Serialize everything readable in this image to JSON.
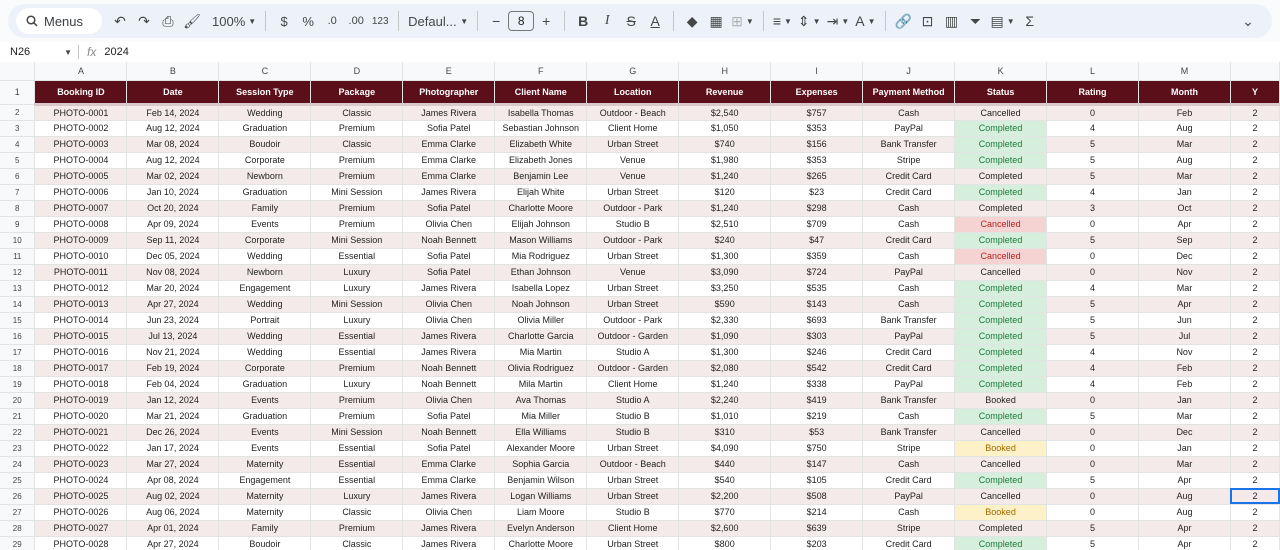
{
  "toolbar": {
    "search_label": "Menus",
    "zoom": "100%",
    "currency": "$",
    "percent": "%",
    "dec_decrease": ".0",
    "dec_increase": ".00",
    "number_format": "123",
    "font": "Defaul...",
    "font_size": "8"
  },
  "formula_bar": {
    "cell_ref": "N26",
    "fx": "fx",
    "value": "2024"
  },
  "columns": [
    "A",
    "B",
    "C",
    "D",
    "E",
    "F",
    "G",
    "H",
    "I",
    "J",
    "K",
    "L",
    "M",
    ""
  ],
  "header_row_number": "1",
  "headers": [
    "Booking ID",
    "Date",
    "Session Type",
    "Package",
    "Photographer",
    "Client Name",
    "Location",
    "Revenue",
    "Expenses",
    "Payment Method",
    "Status",
    "Rating",
    "Month",
    "Y"
  ],
  "rows": [
    {
      "n": "2",
      "cells": [
        "PHOTO-0001",
        "Feb 14, 2024",
        "Wedding",
        "Classic",
        "James Rivera",
        "Isabella Thomas",
        "Outdoor - Beach",
        "$2,540",
        "$757",
        "Cash",
        "Cancelled",
        "0",
        "Feb",
        "2"
      ]
    },
    {
      "n": "3",
      "cells": [
        "PHOTO-0002",
        "Aug 12, 2024",
        "Graduation",
        "Premium",
        "Sofia Patel",
        "Sebastian Johnson",
        "Client Home",
        "$1,050",
        "$353",
        "PayPal",
        "Completed",
        "4",
        "Aug",
        "2"
      ]
    },
    {
      "n": "4",
      "cells": [
        "PHOTO-0003",
        "Mar 08, 2024",
        "Boudoir",
        "Classic",
        "Emma Clarke",
        "Elizabeth White",
        "Urban Street",
        "$740",
        "$156",
        "Bank Transfer",
        "Completed",
        "5",
        "Mar",
        "2"
      ]
    },
    {
      "n": "5",
      "cells": [
        "PHOTO-0004",
        "Aug 12, 2024",
        "Corporate",
        "Premium",
        "Emma Clarke",
        "Elizabeth Jones",
        "Venue",
        "$1,980",
        "$353",
        "Stripe",
        "Completed",
        "5",
        "Aug",
        "2"
      ]
    },
    {
      "n": "6",
      "cells": [
        "PHOTO-0005",
        "Mar 02, 2024",
        "Newborn",
        "Premium",
        "Emma Clarke",
        "Benjamin Lee",
        "Venue",
        "$1,240",
        "$265",
        "Credit Card",
        "Completed",
        "5",
        "Mar",
        "2"
      ]
    },
    {
      "n": "7",
      "cells": [
        "PHOTO-0006",
        "Jan 10, 2024",
        "Graduation",
        "Mini Session",
        "James Rivera",
        "Elijah White",
        "Urban Street",
        "$120",
        "$23",
        "Credit Card",
        "Completed",
        "4",
        "Jan",
        "2"
      ]
    },
    {
      "n": "8",
      "cells": [
        "PHOTO-0007",
        "Oct 20, 2024",
        "Family",
        "Premium",
        "Sofia Patel",
        "Charlotte Moore",
        "Outdoor - Park",
        "$1,240",
        "$298",
        "Cash",
        "Completed",
        "3",
        "Oct",
        "2"
      ]
    },
    {
      "n": "9",
      "cells": [
        "PHOTO-0008",
        "Apr 09, 2024",
        "Events",
        "Premium",
        "Olivia Chen",
        "Elijah Johnson",
        "Studio B",
        "$2,510",
        "$709",
        "Cash",
        "Cancelled",
        "0",
        "Apr",
        "2"
      ]
    },
    {
      "n": "10",
      "cells": [
        "PHOTO-0009",
        "Sep 11, 2024",
        "Corporate",
        "Mini Session",
        "Noah Bennett",
        "Mason Williams",
        "Outdoor - Park",
        "$240",
        "$47",
        "Credit Card",
        "Completed",
        "5",
        "Sep",
        "2"
      ]
    },
    {
      "n": "11",
      "cells": [
        "PHOTO-0010",
        "Dec 05, 2024",
        "Wedding",
        "Essential",
        "Sofia Patel",
        "Mia Rodriguez",
        "Urban Street",
        "$1,300",
        "$359",
        "Cash",
        "Cancelled",
        "0",
        "Dec",
        "2"
      ]
    },
    {
      "n": "12",
      "cells": [
        "PHOTO-0011",
        "Nov 08, 2024",
        "Newborn",
        "Luxury",
        "Sofia Patel",
        "Ethan Johnson",
        "Venue",
        "$3,090",
        "$724",
        "PayPal",
        "Cancelled",
        "0",
        "Nov",
        "2"
      ]
    },
    {
      "n": "13",
      "cells": [
        "PHOTO-0012",
        "Mar 20, 2024",
        "Engagement",
        "Luxury",
        "James Rivera",
        "Isabella Lopez",
        "Urban Street",
        "$3,250",
        "$535",
        "Cash",
        "Completed",
        "4",
        "Mar",
        "2"
      ]
    },
    {
      "n": "14",
      "cells": [
        "PHOTO-0013",
        "Apr 27, 2024",
        "Wedding",
        "Mini Session",
        "Olivia Chen",
        "Noah Johnson",
        "Urban Street",
        "$590",
        "$143",
        "Cash",
        "Completed",
        "5",
        "Apr",
        "2"
      ]
    },
    {
      "n": "15",
      "cells": [
        "PHOTO-0014",
        "Jun 23, 2024",
        "Portrait",
        "Luxury",
        "Olivia Chen",
        "Olivia Miller",
        "Outdoor - Park",
        "$2,330",
        "$693",
        "Bank Transfer",
        "Completed",
        "5",
        "Jun",
        "2"
      ]
    },
    {
      "n": "16",
      "cells": [
        "PHOTO-0015",
        "Jul 13, 2024",
        "Wedding",
        "Essential",
        "James Rivera",
        "Charlotte Garcia",
        "Outdoor - Garden",
        "$1,090",
        "$303",
        "PayPal",
        "Completed",
        "5",
        "Jul",
        "2"
      ]
    },
    {
      "n": "17",
      "cells": [
        "PHOTO-0016",
        "Nov 21, 2024",
        "Wedding",
        "Essential",
        "James Rivera",
        "Mia Martin",
        "Studio A",
        "$1,300",
        "$246",
        "Credit Card",
        "Completed",
        "4",
        "Nov",
        "2"
      ]
    },
    {
      "n": "18",
      "cells": [
        "PHOTO-0017",
        "Feb 19, 2024",
        "Corporate",
        "Premium",
        "Noah Bennett",
        "Olivia Rodriguez",
        "Outdoor - Garden",
        "$2,080",
        "$542",
        "Credit Card",
        "Completed",
        "4",
        "Feb",
        "2"
      ]
    },
    {
      "n": "19",
      "cells": [
        "PHOTO-0018",
        "Feb 04, 2024",
        "Graduation",
        "Luxury",
        "Noah Bennett",
        "Mila Martin",
        "Client Home",
        "$1,240",
        "$338",
        "PayPal",
        "Completed",
        "4",
        "Feb",
        "2"
      ]
    },
    {
      "n": "20",
      "cells": [
        "PHOTO-0019",
        "Jan 12, 2024",
        "Events",
        "Premium",
        "Olivia Chen",
        "Ava Thomas",
        "Studio A",
        "$2,240",
        "$419",
        "Bank Transfer",
        "Booked",
        "0",
        "Jan",
        "2"
      ]
    },
    {
      "n": "21",
      "cells": [
        "PHOTO-0020",
        "Mar 21, 2024",
        "Graduation",
        "Premium",
        "Sofia Patel",
        "Mia Miller",
        "Studio B",
        "$1,010",
        "$219",
        "Cash",
        "Completed",
        "5",
        "Mar",
        "2"
      ]
    },
    {
      "n": "22",
      "cells": [
        "PHOTO-0021",
        "Dec 26, 2024",
        "Events",
        "Mini Session",
        "Noah Bennett",
        "Ella Williams",
        "Studio B",
        "$310",
        "$53",
        "Bank Transfer",
        "Cancelled",
        "0",
        "Dec",
        "2"
      ]
    },
    {
      "n": "23",
      "cells": [
        "PHOTO-0022",
        "Jan 17, 2024",
        "Events",
        "Essential",
        "Sofia Patel",
        "Alexander Moore",
        "Urban Street",
        "$4,090",
        "$750",
        "Stripe",
        "Booked",
        "0",
        "Jan",
        "2"
      ]
    },
    {
      "n": "24",
      "cells": [
        "PHOTO-0023",
        "Mar 27, 2024",
        "Maternity",
        "Essential",
        "Emma Clarke",
        "Sophia Garcia",
        "Outdoor - Beach",
        "$440",
        "$147",
        "Cash",
        "Cancelled",
        "0",
        "Mar",
        "2"
      ]
    },
    {
      "n": "25",
      "cells": [
        "PHOTO-0024",
        "Apr 08, 2024",
        "Engagement",
        "Essential",
        "Emma Clarke",
        "Benjamin Wilson",
        "Urban Street",
        "$540",
        "$105",
        "Credit Card",
        "Completed",
        "5",
        "Apr",
        "2"
      ]
    },
    {
      "n": "26",
      "cells": [
        "PHOTO-0025",
        "Aug 02, 2024",
        "Maternity",
        "Luxury",
        "James Rivera",
        "Logan Williams",
        "Urban Street",
        "$2,200",
        "$508",
        "PayPal",
        "Cancelled",
        "0",
        "Aug",
        "2"
      ]
    },
    {
      "n": "27",
      "cells": [
        "PHOTO-0026",
        "Aug 06, 2024",
        "Maternity",
        "Classic",
        "Olivia Chen",
        "Liam Moore",
        "Studio B",
        "$770",
        "$214",
        "Cash",
        "Booked",
        "0",
        "Aug",
        "2"
      ]
    },
    {
      "n": "28",
      "cells": [
        "PHOTO-0027",
        "Apr 01, 2024",
        "Family",
        "Premium",
        "James Rivera",
        "Evelyn Anderson",
        "Client Home",
        "$2,600",
        "$639",
        "Stripe",
        "Completed",
        "5",
        "Apr",
        "2"
      ]
    },
    {
      "n": "29",
      "cells": [
        "PHOTO-0028",
        "Apr 27, 2024",
        "Boudoir",
        "Classic",
        "James Rivera",
        "Charlotte Moore",
        "Urban Street",
        "$800",
        "$203",
        "Credit Card",
        "Completed",
        "5",
        "Apr",
        "2"
      ]
    }
  ],
  "highlighted_statuses": {
    "Completed": [
      "3",
      "4",
      "5",
      "7",
      "10",
      "13",
      "14",
      "15",
      "16",
      "17",
      "18",
      "19",
      "21",
      "25",
      "29"
    ],
    "Cancelled": [
      "9",
      "11"
    ],
    "Booked": [
      "23",
      "27"
    ]
  }
}
